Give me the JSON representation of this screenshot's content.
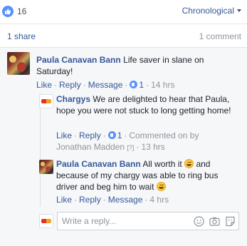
{
  "reactions": {
    "like_count": "16",
    "sort_label": "Chronological"
  },
  "stats": {
    "share_label": "1 share",
    "comment_count": "1 comment"
  },
  "comments": [
    {
      "author": "Paula Canavan Bann",
      "text": "Life saver in slane on Saturday!",
      "like": "Like",
      "reply": "Reply",
      "message": "Message",
      "likes": "1",
      "time": "14 hrs"
    }
  ],
  "replies": [
    {
      "author": "Chargys",
      "text": "We are delighted to hear that Paula, hope you were not stuck to long getting home!",
      "like": "Like",
      "reply": "Reply",
      "likes": "1",
      "commented_on_by": "Commented on by",
      "commenter": "Jonathan Madden",
      "edited_marker": "[?]",
      "time": "13 hrs"
    },
    {
      "author": "Paula Canavan Bann",
      "text_part1": "All worth it",
      "text_part2": "and because of my chargy was able to ring bus driver and beg him to wait",
      "like": "Like",
      "reply": "Reply",
      "message": "Message",
      "time": "4 hrs"
    }
  ],
  "reply_box": {
    "placeholder": "Write a reply..."
  },
  "icons": {
    "like": "thumbs-up-icon",
    "caret": "chevron-down-icon",
    "emoji_input": "smiley-icon",
    "camera": "camera-icon",
    "sticker": "sticker-icon",
    "emoji_inline": "grinning-face-icon"
  },
  "colors": {
    "link": "#365899",
    "like_blue": "#5890ff",
    "muted": "#90949c",
    "background": "#f6f7f9"
  }
}
